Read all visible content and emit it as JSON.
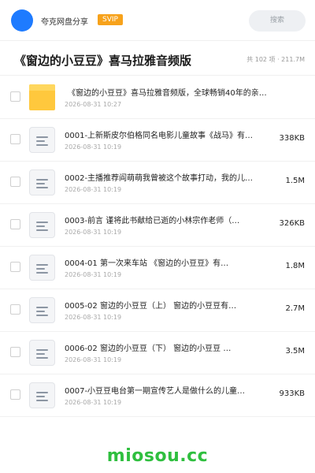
{
  "header": {
    "brand": "夸克网盘分享",
    "badge": "SVIP",
    "search_placeholder": "搜索"
  },
  "folder": {
    "title": "《窗边的小豆豆》喜马拉雅音频版",
    "meta": "共 102 项 · 211.7M"
  },
  "files": [
    {
      "name": "《窗边的小豆豆》喜马拉雅音频版，全球畅销40年的亲…",
      "date": "2026-08-31 10:27",
      "size": "",
      "icon": "folder-icon"
    },
    {
      "name": "0001-上新斯皮尔伯格同名电影儿童故事《战马》有…",
      "date": "2026-08-31 10:19",
      "size": "338KB",
      "icon": "document-icon"
    },
    {
      "name": "0002-主播推荐阎萌萌我曾被这个故事打动，我的儿…",
      "date": "2026-08-31 10:19",
      "size": "1.5M",
      "icon": "document-icon"
    },
    {
      "name": "0003-前言  谨将此书献给已逝的小林宗作老师（…",
      "date": "2026-08-31 10:19",
      "size": "326KB",
      "icon": "document-icon"
    },
    {
      "name": "0004-01 第一次来车站  《窗边的小豆豆》有…",
      "date": "2026-08-31 10:19",
      "size": "1.8M",
      "icon": "document-icon"
    },
    {
      "name": "0005-02 窗边的小豆豆（上）  窗边的小豆豆有…",
      "date": "2026-08-31 10:19",
      "size": "2.7M",
      "icon": "document-icon"
    },
    {
      "name": "0006-02 窗边的小豆豆（下）  窗边的小豆豆 …",
      "date": "2026-08-31 10:19",
      "size": "3.5M",
      "icon": "document-icon"
    },
    {
      "name": "0007-小豆豆电台第一期宣传艺人是做什么的儿童…",
      "date": "2026-08-31 10:19",
      "size": "933KB",
      "icon": "document-icon"
    }
  ],
  "watermark": "miosou.cc",
  "colors": {
    "accent": "#1e7bff",
    "badge": "#f7a21b",
    "folder": "#ffc83d",
    "watermark": "#2fbf3f"
  }
}
